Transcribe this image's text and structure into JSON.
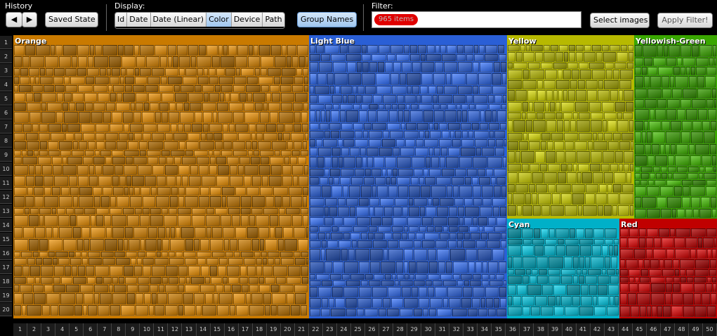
{
  "toolbar": {
    "history_label": "History",
    "back_icon": "triangle-left-icon",
    "forward_icon": "triangle-right-icon",
    "saved_state_label": "Saved State",
    "display_label": "Display:",
    "display_options": [
      "Id",
      "Date",
      "Date (Linear)",
      "Color",
      "Device",
      "Path"
    ],
    "display_selected": "Color",
    "group_names_label": "Group Names",
    "filter_label": "Filter:",
    "filter_chip": "965 items",
    "select_images_label": "Select images",
    "apply_filter_label": "Apply Filter!"
  },
  "row_axis": [
    "1",
    "2",
    "3",
    "4",
    "5",
    "6",
    "7",
    "8",
    "9",
    "10",
    "11",
    "12",
    "13",
    "14",
    "15",
    "16",
    "17",
    "18",
    "19",
    "20"
  ],
  "col_axis": [
    "1",
    "2",
    "3",
    "4",
    "5",
    "6",
    "7",
    "8",
    "9",
    "10",
    "11",
    "12",
    "13",
    "14",
    "15",
    "16",
    "17",
    "18",
    "19",
    "20",
    "21",
    "22",
    "23",
    "24",
    "25",
    "26",
    "27",
    "28",
    "29",
    "30",
    "31",
    "32",
    "33",
    "34",
    "35",
    "36",
    "37",
    "38",
    "39",
    "40",
    "41",
    "42",
    "43",
    "44",
    "45",
    "46",
    "47",
    "48",
    "49",
    "50"
  ],
  "groups": [
    {
      "name": "Orange",
      "color": "#c97a00"
    },
    {
      "name": "Light Blue",
      "color": "#2a5fd6"
    },
    {
      "name": "Yellow",
      "color": "#b7b900"
    },
    {
      "name": "Yellowish-Green",
      "color": "#3aa600"
    },
    {
      "name": "Cyan",
      "color": "#00b0c8"
    },
    {
      "name": "Red",
      "color": "#c00000"
    }
  ]
}
